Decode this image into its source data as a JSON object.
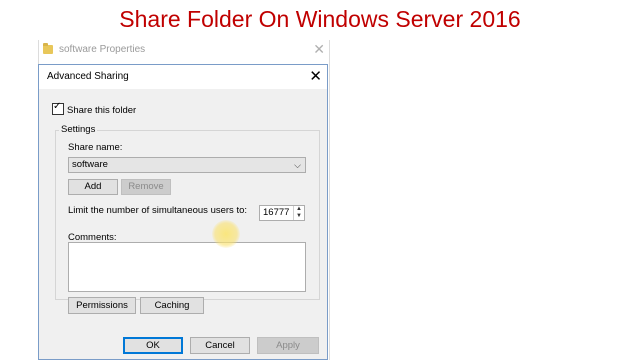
{
  "header": {
    "title": "Share Folder On Windows Server 2016"
  },
  "background_window": {
    "title": "software Properties"
  },
  "dialog": {
    "title": "Advanced Sharing",
    "share_checkbox_label": "Share this folder",
    "share_checked": true,
    "settings_group_label": "Settings",
    "share_name_label": "Share name:",
    "share_name_value": "software",
    "add_label": "Add",
    "remove_label": "Remove",
    "limit_label": "Limit the number of simultaneous users to:",
    "limit_value": "16777",
    "comments_label": "Comments:",
    "comments_value": "",
    "permissions_label": "Permissions",
    "caching_label": "Caching",
    "ok_label": "OK",
    "cancel_label": "Cancel",
    "apply_label": "Apply"
  },
  "colors": {
    "title_red": "#c00000",
    "accent_blue": "#0078d7",
    "cursor_highlight": "#f5dc6e"
  },
  "icons": {
    "close": "close-icon",
    "folder": "folder-icon",
    "dropdown": "chevron-down-icon",
    "spin_up": "spin-up-icon",
    "spin_down": "spin-down-icon"
  }
}
